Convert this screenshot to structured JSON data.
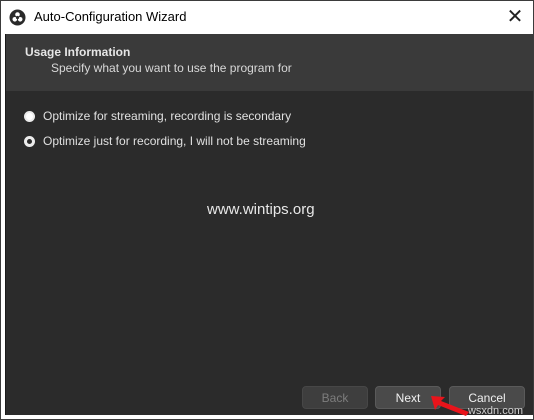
{
  "window": {
    "title": "Auto-Configuration Wizard"
  },
  "header": {
    "title": "Usage Information",
    "subtitle": "Specify what you want to use the program for"
  },
  "options": [
    {
      "label": "Optimize for streaming, recording is secondary",
      "selected": false
    },
    {
      "label": "Optimize just for recording, I will not be streaming",
      "selected": true
    }
  ],
  "watermark": "www.wintips.org",
  "buttons": {
    "back": "Back",
    "next": "Next",
    "cancel": "Cancel"
  },
  "corner_mark": "wsxdn.com",
  "colors": {
    "panel": "#2b2b2b",
    "header": "#3a3a3a",
    "arrow": "#e8141b"
  }
}
